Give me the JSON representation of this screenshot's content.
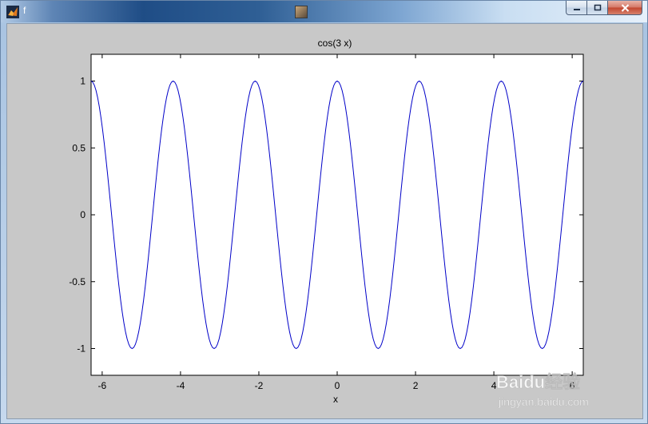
{
  "window": {
    "title": "f",
    "caption_buttons": [
      "minimize",
      "maximize",
      "close"
    ],
    "app_icon": "matlab-icon"
  },
  "colors": {
    "figure_background": "#c8c8c8",
    "axes_background": "#ffffff",
    "line_color": "#0000c8"
  },
  "chart_data": {
    "type": "line",
    "title": "cos(3 x)",
    "xlabel": "x",
    "ylabel": "",
    "xlim": [
      -6.2832,
      6.2832
    ],
    "ylim": [
      -1.2,
      1.2
    ],
    "xticks": [
      -6,
      -4,
      -2,
      0,
      2,
      4,
      6
    ],
    "xtick_labels": [
      "-6",
      "-4",
      "-2",
      "0",
      "2",
      "4",
      "6"
    ],
    "yticks": [
      -1,
      -0.5,
      0,
      0.5,
      1
    ],
    "ytick_labels": [
      "-1",
      "-0.5",
      "0",
      "0.5",
      "1"
    ],
    "grid": false,
    "series": [
      {
        "function": "cos(3 x)",
        "x_range": [
          -6.2832,
          6.2832
        ],
        "samples": 300
      }
    ]
  },
  "watermark": {
    "text_main": "Baidu经验",
    "text_sub": "jingyan.baidu.com"
  }
}
